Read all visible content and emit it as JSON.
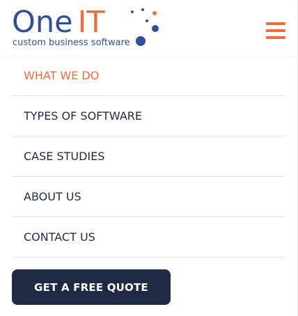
{
  "brand": {
    "name_part1": "One",
    "name_part2": "IT",
    "tagline": "custom business software",
    "colors": {
      "primary": "#2f4f9c",
      "accent": "#f26b3a",
      "dark": "#1f2a44"
    }
  },
  "header": {
    "menu_icon": "hamburger-menu-icon"
  },
  "nav": {
    "items": [
      {
        "label": "WHAT WE DO",
        "active": true
      },
      {
        "label": "TYPES OF SOFTWARE",
        "active": false
      },
      {
        "label": "CASE STUDIES",
        "active": false
      },
      {
        "label": "ABOUT US",
        "active": false
      },
      {
        "label": "CONTACT US",
        "active": false
      }
    ]
  },
  "cta": {
    "label": "GET A FREE QUOTE"
  }
}
